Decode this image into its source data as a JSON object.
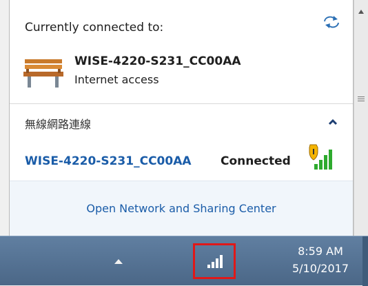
{
  "flyout": {
    "connected_label": "Currently connected to:",
    "current_network": {
      "name": "WISE-4220-S231_CC00AA",
      "access": "Internet access"
    },
    "group_title": "無線網路連線",
    "networks": [
      {
        "name": "WISE-4220-S231_CC00AA",
        "status": "Connected"
      }
    ],
    "footer_link": "Open Network and Sharing Center"
  },
  "taskbar": {
    "time": "8:59 AM",
    "date": "5/10/2017"
  },
  "colors": {
    "link": "#1a5ca8",
    "taskbar": "#56728f",
    "highlight": "#e01818",
    "signal": "#2eaa2e",
    "shield": "#f4b400"
  }
}
